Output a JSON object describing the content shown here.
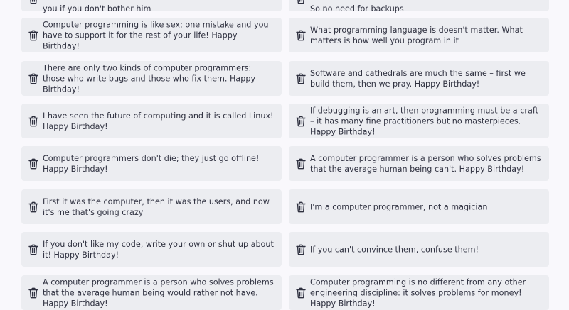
{
  "colors": {
    "page_bg": "#f9f8fc",
    "card_bg": "#ecedf1",
    "text": "#2f3140",
    "icon": "#2f3140"
  },
  "icons": {
    "delete": "trash-icon"
  },
  "quotes": [
    {
      "left": "you if you don't bother him",
      "right": "So no need for backups"
    },
    {
      "left": "Computer programming is like sex; one mistake and you have to support it for the rest of your life! Happy Birthday!",
      "right": "What programming language is doesn't matter. What matters is how well you program in it"
    },
    {
      "left": "There are only two kinds of computer programmers: those who write bugs and those who fix them. Happy Birthday!",
      "right": "Software and cathedrals are much the same – first we build them, then we pray. Happy Birthday!"
    },
    {
      "left": "I have seen the future of computing and it is called Linux! Happy Birthday!",
      "right": "If debugging is an art, then programming must be a craft – it has many fine practitioners but no masterpieces. Happy Birthday!"
    },
    {
      "left": "Computer programmers don't die; they just go offline! Happy Birthday!",
      "right": "A computer programmer is a person who solves problems that the average human being can't. Happy Birthday!"
    },
    {
      "left": "First it was the computer, then it was the users, and now it's me that's going crazy",
      "right": "I'm a computer programmer, not a magician"
    },
    {
      "left": "If you don't like my code, write your own or shut up about it! Happy Birthday!",
      "right": "If you can't convince them, confuse them!"
    },
    {
      "left": "A computer programmer is a person who solves problems that the average human being would rather not have. Happy Birthday!",
      "right": "Computer programming is no different from any other engineering discipline: it solves problems for money! Happy Birthday!"
    }
  ]
}
